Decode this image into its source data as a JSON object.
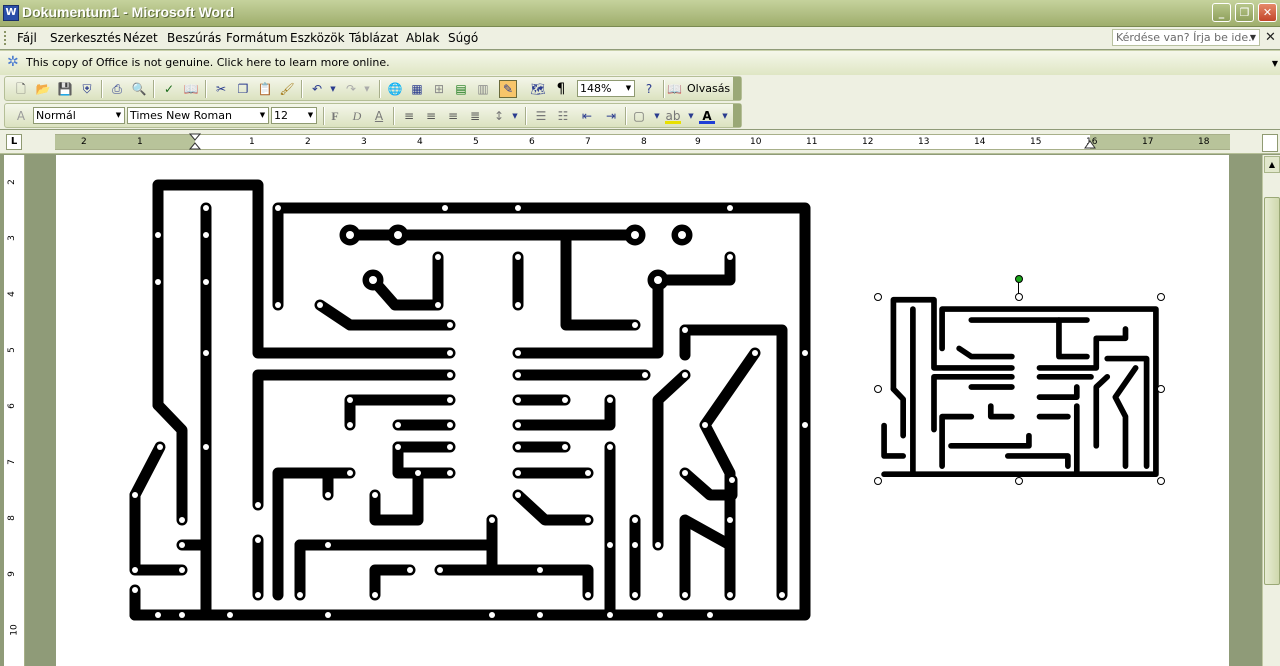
{
  "window": {
    "title": "Dokumentum1 - Microsoft Word",
    "app_icon_letter": "W",
    "min_glyph": "_",
    "max_glyph": "❐",
    "close_glyph": "✕"
  },
  "menu": {
    "items": [
      "Fájl",
      "Szerkesztés",
      "Nézet",
      "Beszúrás",
      "Formátum",
      "Eszközök",
      "Táblázat",
      "Ablak",
      "Súgó"
    ],
    "ask_placeholder": "Kérdése van? Írja be ide.",
    "close_glyph": "✕"
  },
  "notice": {
    "text": "This copy of Office is not genuine.  Click here to learn more online."
  },
  "standard_toolbar": {
    "zoom": "148%",
    "reading_label": "Olvasás"
  },
  "formatting_toolbar": {
    "style": "Normál",
    "font": "Times New Roman",
    "size": "12",
    "bold": "F",
    "italic": "D",
    "underline": "A"
  },
  "ruler": {
    "h_numbers": [
      "2",
      "1",
      "1",
      "2",
      "3",
      "4",
      "5",
      "6",
      "7",
      "8",
      "9",
      "10",
      "11",
      "12",
      "13",
      "14",
      "15",
      "16",
      "17",
      "18"
    ],
    "v_numbers": [
      "2",
      "3",
      "4",
      "5",
      "6",
      "7",
      "8",
      "9",
      "10"
    ],
    "tab_glyph": "L"
  },
  "icons": {
    "new": "new-doc-icon",
    "open": "open-folder-icon",
    "save": "save-icon",
    "permission": "permission-icon",
    "print": "print-icon",
    "preview": "print-preview-icon",
    "spell": "spelling-icon",
    "research": "research-icon",
    "cut": "cut-icon",
    "copy": "copy-icon",
    "paste": "paste-icon",
    "painter": "format-painter-icon",
    "undo": "undo-icon",
    "redo": "redo-icon",
    "hyperlink": "hyperlink-icon",
    "tables_borders": "tables-borders-icon",
    "insert_table": "insert-table-icon",
    "insert_excel": "insert-excel-icon",
    "columns": "columns-icon",
    "drawing": "drawing-icon",
    "doc_map": "document-map-icon",
    "pilcrow": "show-hide-icon",
    "help": "help-icon"
  },
  "colors": {
    "titlebar": "#aebc80",
    "menubar": "#eef0e2",
    "font_color_bar": "#1f3fd6",
    "highlight_bar": "#e8e000",
    "selection_handle": "#1ba51b"
  }
}
